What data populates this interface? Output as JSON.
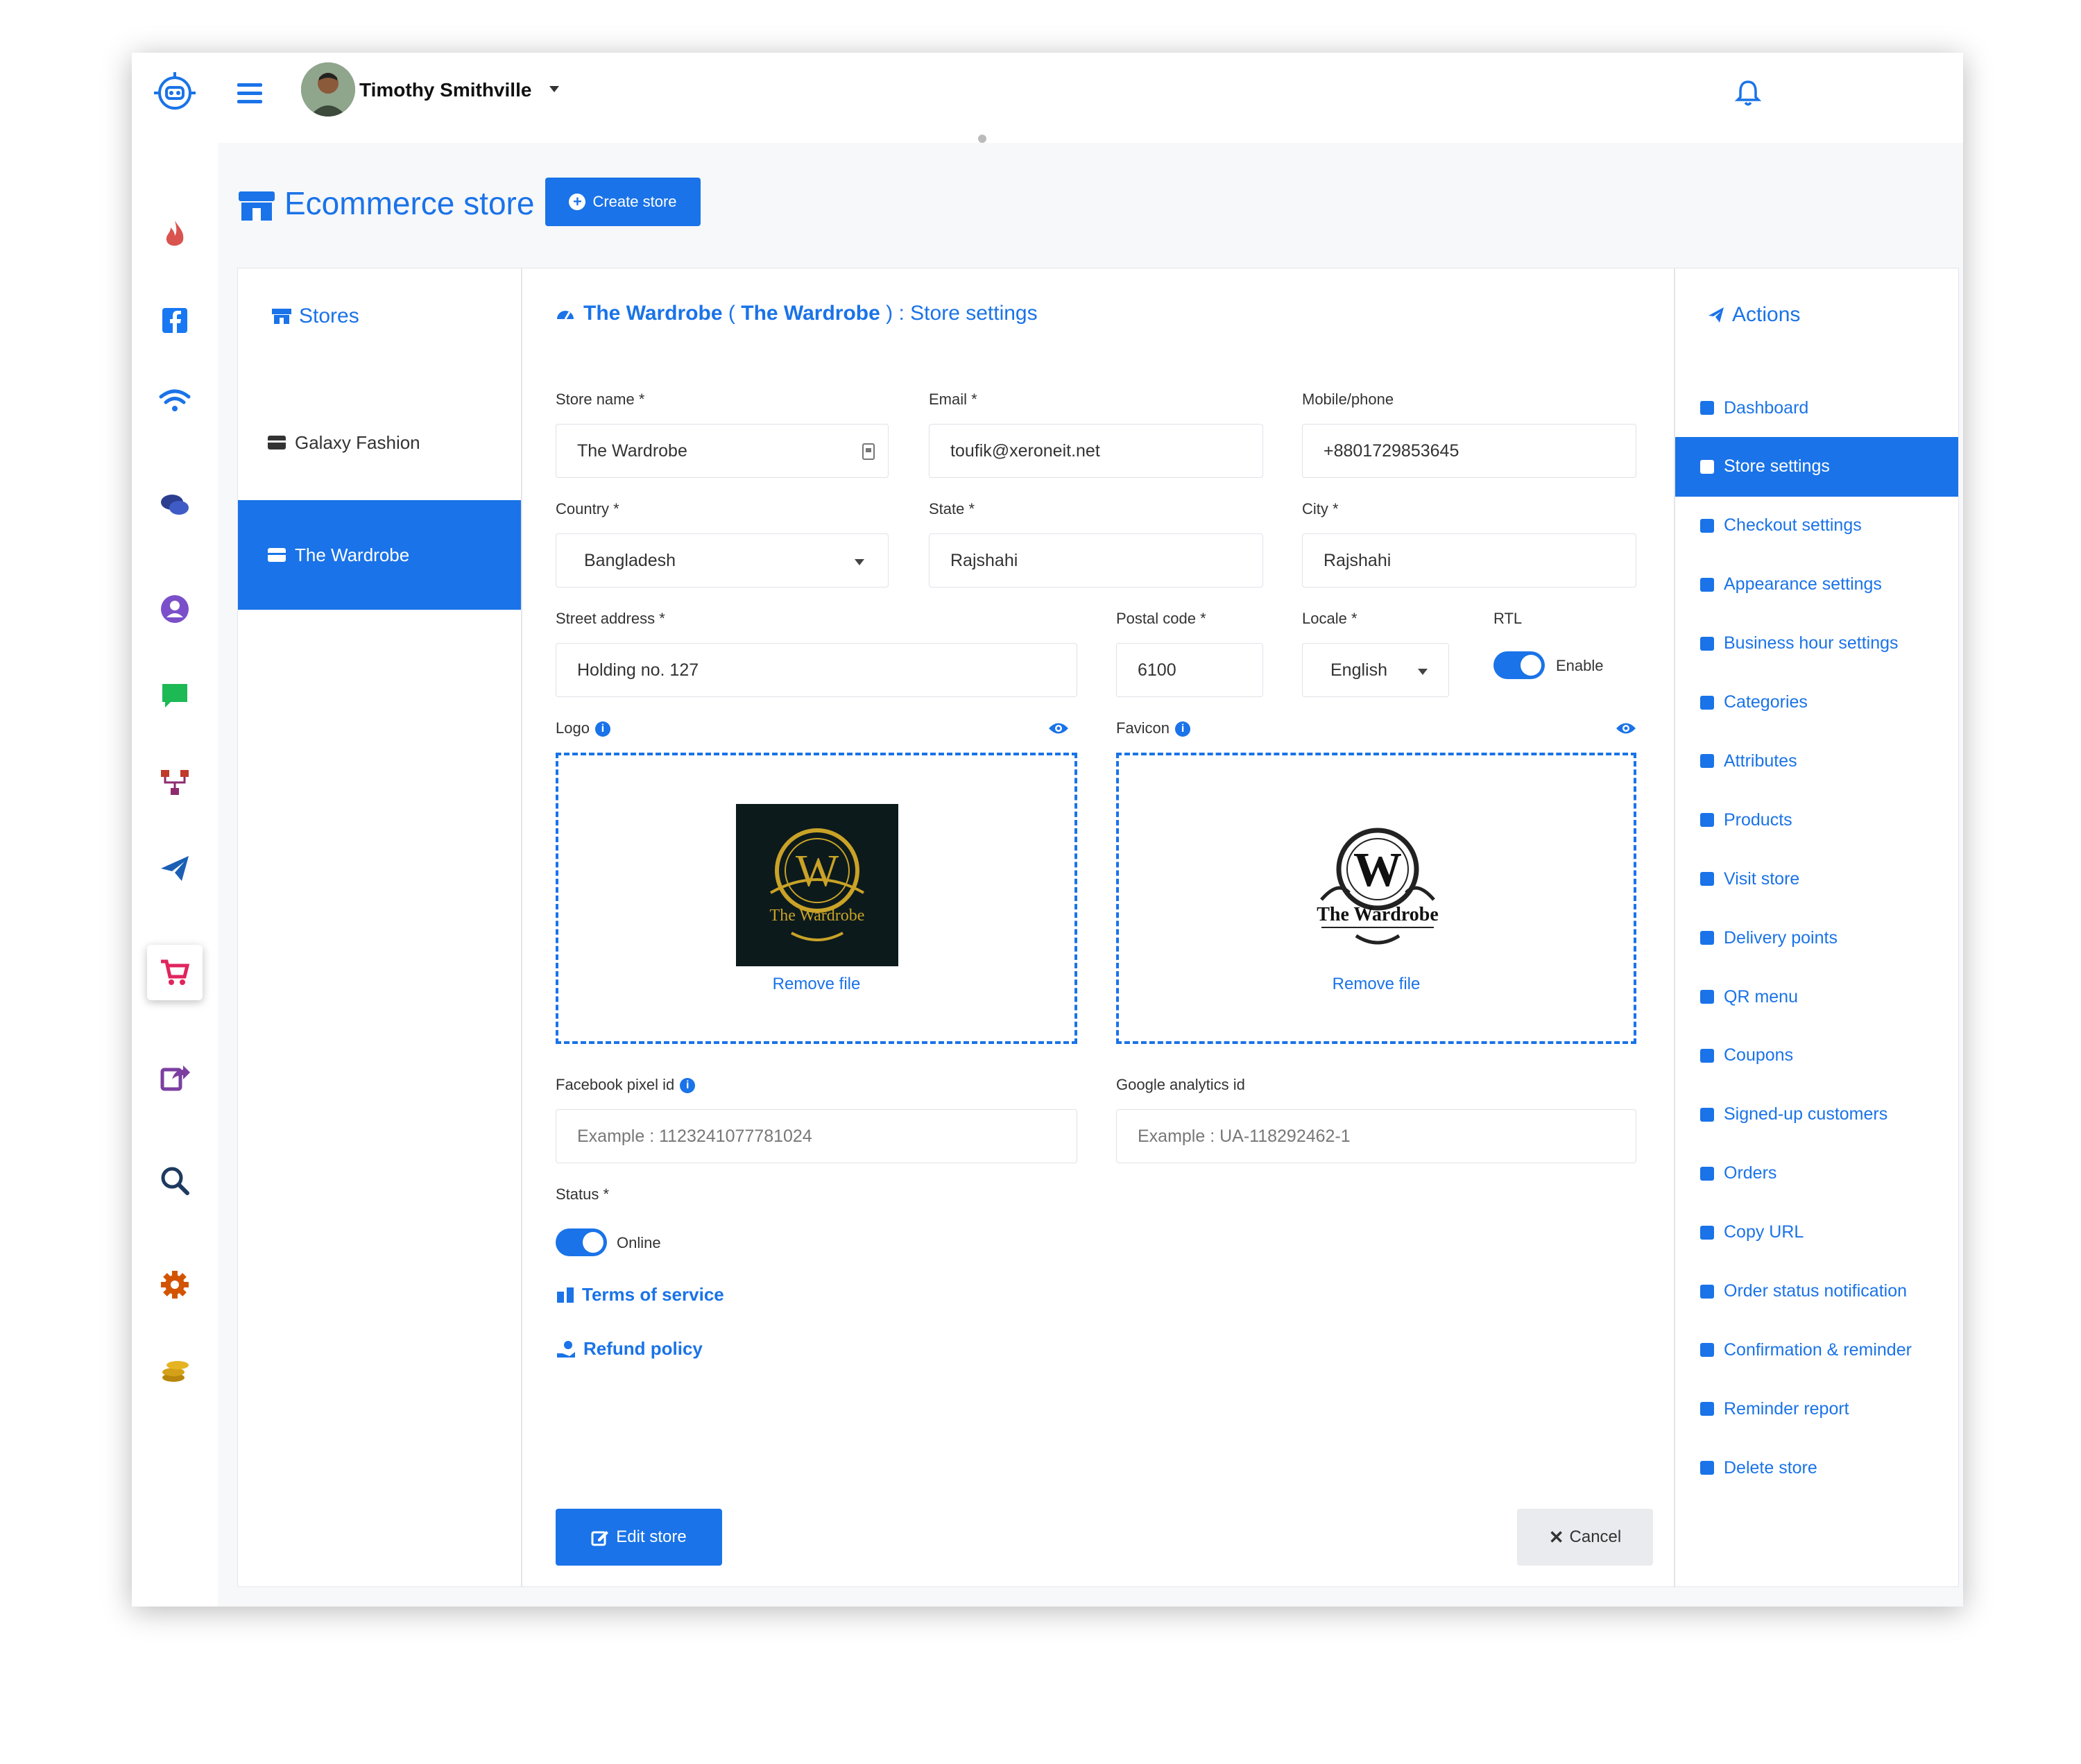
{
  "user": {
    "name": "Timothy Smithville"
  },
  "page": {
    "title": "Ecommerce store",
    "create_label": "Create store"
  },
  "stores": {
    "heading": "Stores",
    "items": [
      {
        "label": "Galaxy Fashion"
      },
      {
        "label": "The Wardrobe"
      }
    ]
  },
  "settings": {
    "store_bold": "The Wardrobe",
    "paren_open": " ( ",
    "store_bold2": "The Wardrobe",
    "paren_close": " ) ",
    "suffix": ": Store settings"
  },
  "form": {
    "store_name": {
      "label": "Store name *",
      "value": "The Wardrobe"
    },
    "email": {
      "label": "Email *",
      "value": "toufik@xeroneit.net"
    },
    "mobile": {
      "label": "Mobile/phone",
      "value": "+8801729853645"
    },
    "country": {
      "label": "Country *",
      "value": "Bangladesh"
    },
    "state": {
      "label": "State *",
      "value": "Rajshahi"
    },
    "city": {
      "label": "City *",
      "value": "Rajshahi"
    },
    "street": {
      "label": "Street address *",
      "value": "Holding no. 127"
    },
    "postal": {
      "label": "Postal code *",
      "value": "6100"
    },
    "locale": {
      "label": "Locale *",
      "value": "English"
    },
    "rtl": {
      "label": "RTL",
      "toggle_label": "Enable"
    },
    "logo": {
      "label": "Logo",
      "remove": "Remove file",
      "brand_letter": "W",
      "brand_name": "The Wardrobe"
    },
    "favicon": {
      "label": "Favicon",
      "remove": "Remove file",
      "brand_letter": "W",
      "brand_name": "The Wardrobe"
    },
    "fb_pixel": {
      "label": "Facebook pixel id",
      "placeholder": "Example : 1123241077781024"
    },
    "ga": {
      "label": "Google analytics id",
      "placeholder": "Example : UA-118292462-1"
    },
    "status": {
      "label": "Status *",
      "toggle_label": "Online"
    },
    "terms": "Terms of service",
    "refund": "Refund policy",
    "edit_label": "Edit store",
    "cancel_label": "Cancel"
  },
  "actions": {
    "heading": "Actions",
    "items": [
      {
        "label": "Dashboard"
      },
      {
        "label": "Store settings"
      },
      {
        "label": "Checkout settings"
      },
      {
        "label": "Appearance settings"
      },
      {
        "label": "Business hour settings"
      },
      {
        "label": "Categories"
      },
      {
        "label": "Attributes"
      },
      {
        "label": "Products"
      },
      {
        "label": "Visit store"
      },
      {
        "label": "Delivery points"
      },
      {
        "label": "QR menu"
      },
      {
        "label": "Coupons"
      },
      {
        "label": "Signed-up customers"
      },
      {
        "label": "Orders"
      },
      {
        "label": "Copy URL"
      },
      {
        "label": "Order status notification"
      },
      {
        "label": "Confirmation & reminder"
      },
      {
        "label": "Reminder report"
      },
      {
        "label": "Delete store"
      }
    ]
  },
  "colors": {
    "accent": "#1a73e8",
    "panel_border": "#e4e6eb"
  },
  "rail_icons": [
    "fire-icon",
    "facebook-icon",
    "wifi-icon",
    "chat-bubbles-icon",
    "user-circle-icon",
    "message-icon",
    "sitemap-icon",
    "paper-plane-icon",
    "cart-icon",
    "share-icon",
    "search-icon",
    "gear-icon",
    "coins-icon"
  ]
}
